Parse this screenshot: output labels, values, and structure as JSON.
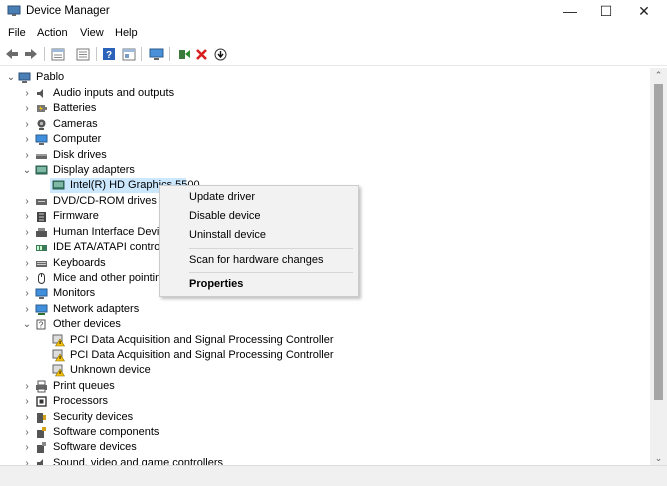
{
  "window": {
    "title": "Device Manager",
    "controls": {
      "minimize": "—",
      "maximize": "☐",
      "close": "✕"
    }
  },
  "menubar": [
    "File",
    "Action",
    "View",
    "Help"
  ],
  "toolbar": {
    "icons": [
      "back-icon",
      "forward-icon",
      "properties-view-icon",
      "show-hidden-icon",
      "help-icon",
      "action-icon",
      "monitor-icon",
      "update-driver-icon",
      "uninstall-icon",
      "download-icon"
    ]
  },
  "tree": {
    "root": "Pablo",
    "items": [
      {
        "label": "Audio inputs and outputs",
        "icon": "speaker-icon",
        "level": 1,
        "expanded": false
      },
      {
        "label": "Batteries",
        "icon": "battery-icon",
        "level": 1,
        "expanded": false
      },
      {
        "label": "Cameras",
        "icon": "camera-icon",
        "level": 1,
        "expanded": false
      },
      {
        "label": "Computer",
        "icon": "computer-icon",
        "level": 1,
        "expanded": false
      },
      {
        "label": "Disk drives",
        "icon": "disk-drive-icon",
        "level": 1,
        "expanded": false
      },
      {
        "label": "Display adapters",
        "icon": "display-adapter-icon",
        "level": 1,
        "expanded": true
      },
      {
        "label": "Intel(R) HD Graphics 5500",
        "icon": "display-adapter-icon",
        "level": 2,
        "selected": true
      },
      {
        "label": "DVD/CD-ROM drives",
        "icon": "dvd-icon",
        "level": 1,
        "expanded": false
      },
      {
        "label": "Firmware",
        "icon": "firmware-icon",
        "level": 1,
        "expanded": false
      },
      {
        "label": "Human Interface Devices",
        "icon": "hid-icon",
        "level": 1,
        "expanded": false
      },
      {
        "label": "IDE ATA/ATAPI controllers",
        "icon": "ide-controller-icon",
        "level": 1,
        "expanded": false
      },
      {
        "label": "Keyboards",
        "icon": "keyboard-icon",
        "level": 1,
        "expanded": false
      },
      {
        "label": "Mice and other pointing devices",
        "icon": "mouse-icon",
        "level": 1,
        "expanded": false
      },
      {
        "label": "Monitors",
        "icon": "monitor-icon",
        "level": 1,
        "expanded": false
      },
      {
        "label": "Network adapters",
        "icon": "network-adapter-icon",
        "level": 1,
        "expanded": false
      },
      {
        "label": "Other devices",
        "icon": "other-devices-icon",
        "level": 1,
        "expanded": true
      },
      {
        "label": "PCI Data Acquisition and Signal Processing Controller",
        "icon": "unknown-device-warning-icon",
        "level": 2
      },
      {
        "label": "PCI Data Acquisition and Signal Processing Controller",
        "icon": "unknown-device-warning-icon",
        "level": 2
      },
      {
        "label": "Unknown device",
        "icon": "unknown-device-warning-icon",
        "level": 2
      },
      {
        "label": "Print queues",
        "icon": "printer-icon",
        "level": 1,
        "expanded": false
      },
      {
        "label": "Processors",
        "icon": "processor-icon",
        "level": 1,
        "expanded": false
      },
      {
        "label": "Security devices",
        "icon": "security-device-icon",
        "level": 1,
        "expanded": false
      },
      {
        "label": "Software components",
        "icon": "software-component-icon",
        "level": 1,
        "expanded": false
      },
      {
        "label": "Software devices",
        "icon": "software-device-icon",
        "level": 1,
        "expanded": false
      },
      {
        "label": "Sound, video and game controllers",
        "icon": "sound-icon",
        "level": 1,
        "expanded": false
      }
    ]
  },
  "context_menu": {
    "items": [
      "Update driver",
      "Disable device",
      "Uninstall device",
      "Scan for hardware changes",
      "Properties"
    ]
  },
  "colors": {
    "selection": "#cce8ff",
    "menu_bg": "#f2f2f2",
    "uninstall_red": "#d81e1e",
    "update_green": "#2e8b2e",
    "warning_yellow": "#f4c20d"
  }
}
